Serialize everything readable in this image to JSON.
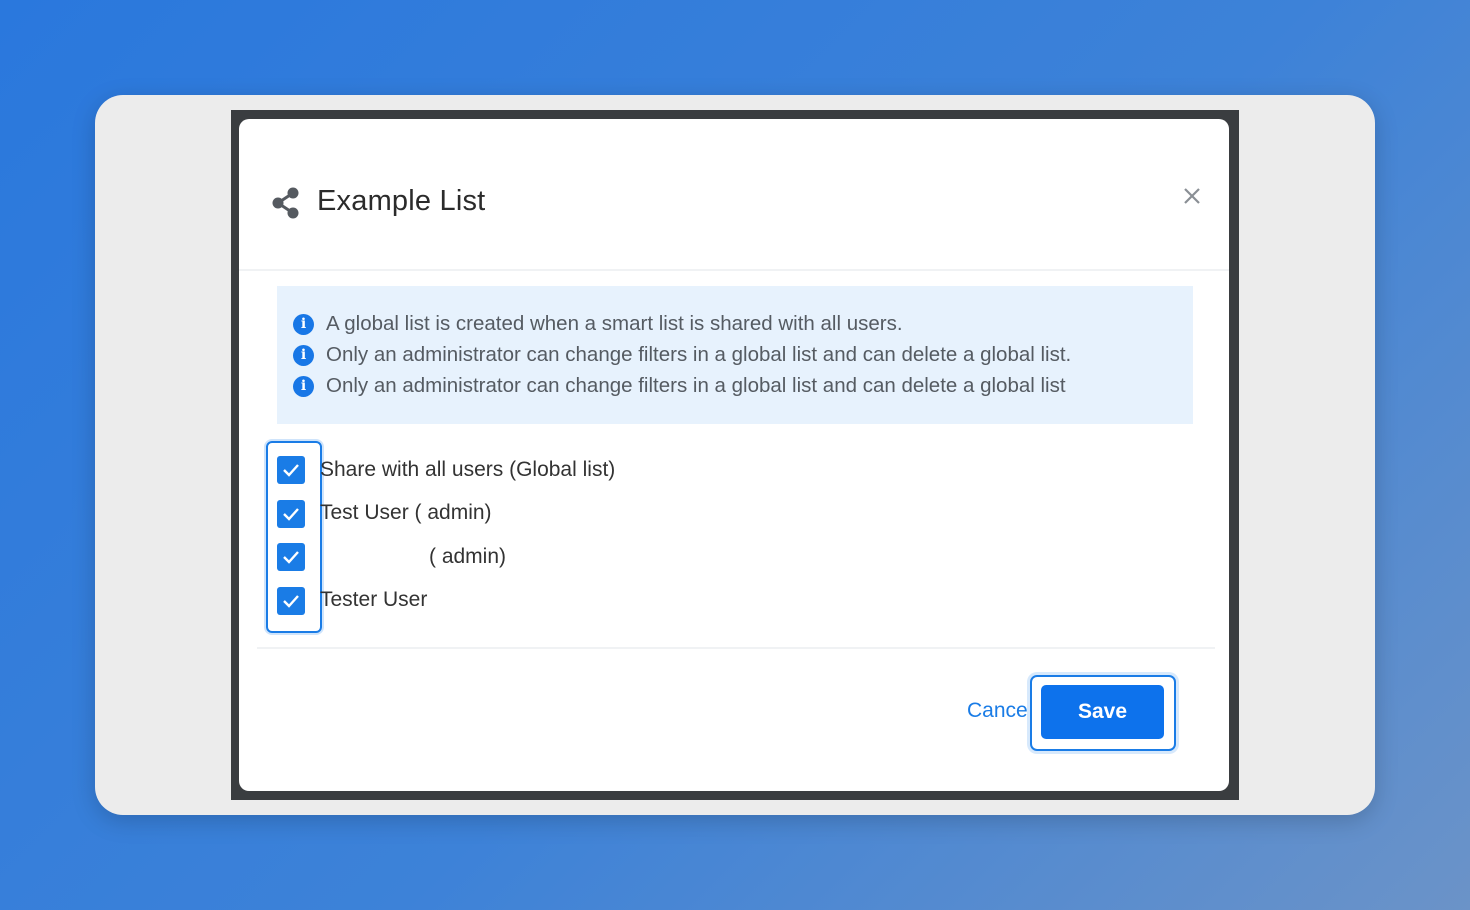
{
  "dialog": {
    "title": "Example List",
    "info_messages": [
      "A global list is created when a smart list is shared with all users.",
      "Only an administrator can change filters in a global list and can delete a global list.",
      "Only an administrator can change filters in a global list and can delete a global list"
    ],
    "checkboxes": [
      {
        "label": "Share with all users (Global list)",
        "checked": true
      },
      {
        "label": "Test User ( admin)",
        "checked": true
      },
      {
        "label": "( admin)",
        "checked": true
      },
      {
        "label": "Tester User",
        "checked": true
      }
    ],
    "cancel_label": "Cancel",
    "save_label": "Save"
  },
  "icons": {
    "title_icon": "share-icon",
    "close": "close-icon",
    "info": "info-icon",
    "check": "check-icon"
  },
  "colors": {
    "primary": "#1a7ce6",
    "save_button": "#0d72ec",
    "info_background": "#e7f2fd",
    "background_gradient_start": "#2a78dd",
    "frame": "#ececec"
  }
}
